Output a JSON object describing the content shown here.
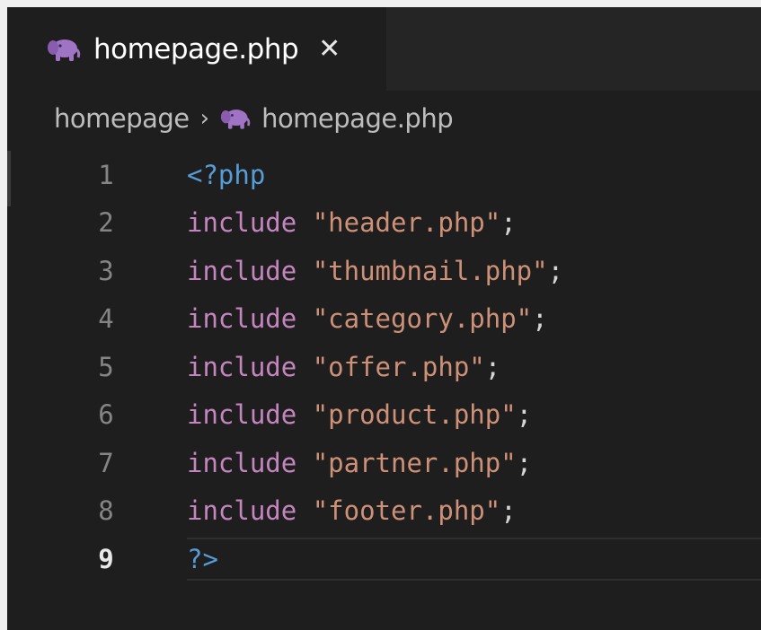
{
  "tab": {
    "filename": "homepage.php",
    "close_symbol": "✕",
    "icon": "php-elephant-icon"
  },
  "breadcrumb": {
    "folder": "homepage",
    "separator": "›",
    "file": "homepage.php",
    "file_icon": "php-elephant-icon"
  },
  "editor": {
    "current_line": 9,
    "lines": [
      {
        "num": "1",
        "tokens": [
          {
            "t": "<?php",
            "k": "tag"
          }
        ]
      },
      {
        "num": "2",
        "tokens": [
          {
            "t": "include",
            "k": "kw"
          },
          {
            "t": " ",
            "k": "punc"
          },
          {
            "t": "\"header.php\"",
            "k": "str"
          },
          {
            "t": ";",
            "k": "punc"
          }
        ]
      },
      {
        "num": "3",
        "tokens": [
          {
            "t": "include",
            "k": "kw"
          },
          {
            "t": " ",
            "k": "punc"
          },
          {
            "t": "\"thumbnail.php\"",
            "k": "str"
          },
          {
            "t": ";",
            "k": "punc"
          }
        ]
      },
      {
        "num": "4",
        "tokens": [
          {
            "t": "include",
            "k": "kw"
          },
          {
            "t": " ",
            "k": "punc"
          },
          {
            "t": "\"category.php\"",
            "k": "str"
          },
          {
            "t": ";",
            "k": "punc"
          }
        ]
      },
      {
        "num": "5",
        "tokens": [
          {
            "t": "include",
            "k": "kw"
          },
          {
            "t": " ",
            "k": "punc"
          },
          {
            "t": "\"offer.php\"",
            "k": "str"
          },
          {
            "t": ";",
            "k": "punc"
          }
        ]
      },
      {
        "num": "6",
        "tokens": [
          {
            "t": "include",
            "k": "kw"
          },
          {
            "t": " ",
            "k": "punc"
          },
          {
            "t": "\"product.php\"",
            "k": "str"
          },
          {
            "t": ";",
            "k": "punc"
          }
        ]
      },
      {
        "num": "7",
        "tokens": [
          {
            "t": "include",
            "k": "kw"
          },
          {
            "t": " ",
            "k": "punc"
          },
          {
            "t": "\"partner.php\"",
            "k": "str"
          },
          {
            "t": ";",
            "k": "punc"
          }
        ]
      },
      {
        "num": "8",
        "tokens": [
          {
            "t": "include",
            "k": "kw"
          },
          {
            "t": " ",
            "k": "punc"
          },
          {
            "t": "\"footer.php\"",
            "k": "str"
          },
          {
            "t": ";",
            "k": "punc"
          }
        ]
      },
      {
        "num": "9",
        "tokens": [
          {
            "t": "?>",
            "k": "tag"
          }
        ]
      }
    ]
  },
  "colors": {
    "editor_bg": "#1e1e1e",
    "tab_strip_bg": "#252526",
    "keyword": "#c586c0",
    "string": "#ce9178",
    "php_tag": "#569cd6",
    "icon_purple": "#a074c4"
  }
}
